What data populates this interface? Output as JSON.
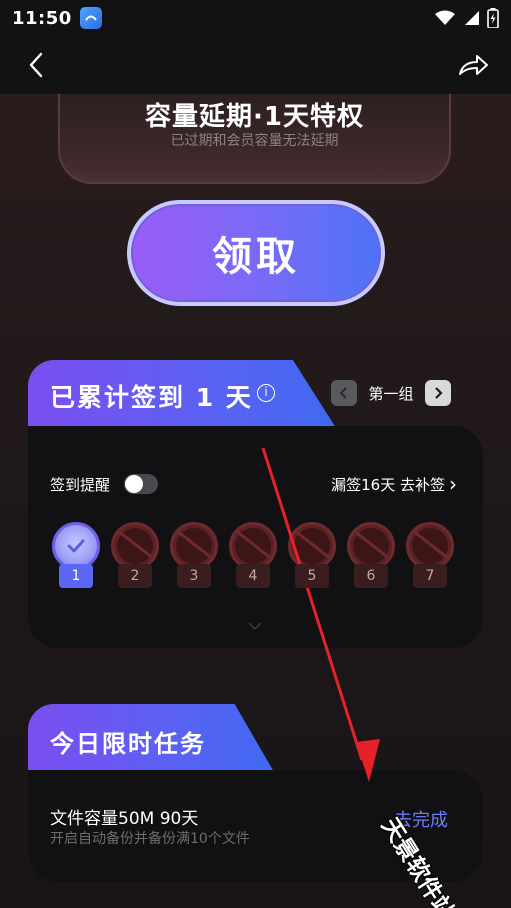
{
  "status": {
    "time": "11:50"
  },
  "icons": {
    "app": "app-icon",
    "wifi": "wifi-icon",
    "signal": "signal-icon",
    "battery": "battery-charging-icon",
    "back": "back-arrow-icon",
    "share": "share-icon",
    "info": "info-icon",
    "prev": "chevron-left-icon",
    "next": "chevron-right-icon",
    "check": "check-icon",
    "expand": "chevron-down-icon"
  },
  "reward_card": {
    "title": "容量延期·1天特权",
    "subtitle": "已过期和会员容量无法延期"
  },
  "claim_button": {
    "label": "领取"
  },
  "checkin": {
    "title": "已累计签到 1 天",
    "info": "i",
    "group_label": "第一组",
    "reminder_label": "签到提醒",
    "reminder_on": false,
    "missed_text": "漏签16天 去补签",
    "missed_chevron": "›",
    "days": [
      {
        "label": "1",
        "status": "done"
      },
      {
        "label": "2",
        "status": "locked"
      },
      {
        "label": "3",
        "status": "locked"
      },
      {
        "label": "4",
        "status": "locked"
      },
      {
        "label": "5",
        "status": "locked"
      },
      {
        "label": "6",
        "status": "locked"
      },
      {
        "label": "7",
        "status": "locked"
      }
    ]
  },
  "tasks": {
    "section_title": "今日限时任务",
    "items": [
      {
        "title": "文件容量50M 90天",
        "subtitle": "开启自动备份并备份满10个文件",
        "action": "去完成"
      }
    ]
  },
  "watermark": {
    "text": "天景软件站"
  },
  "colors": {
    "accent": "#5a62f3",
    "link": "#6b7cf7",
    "annotation_arrow": "#e5222a"
  }
}
